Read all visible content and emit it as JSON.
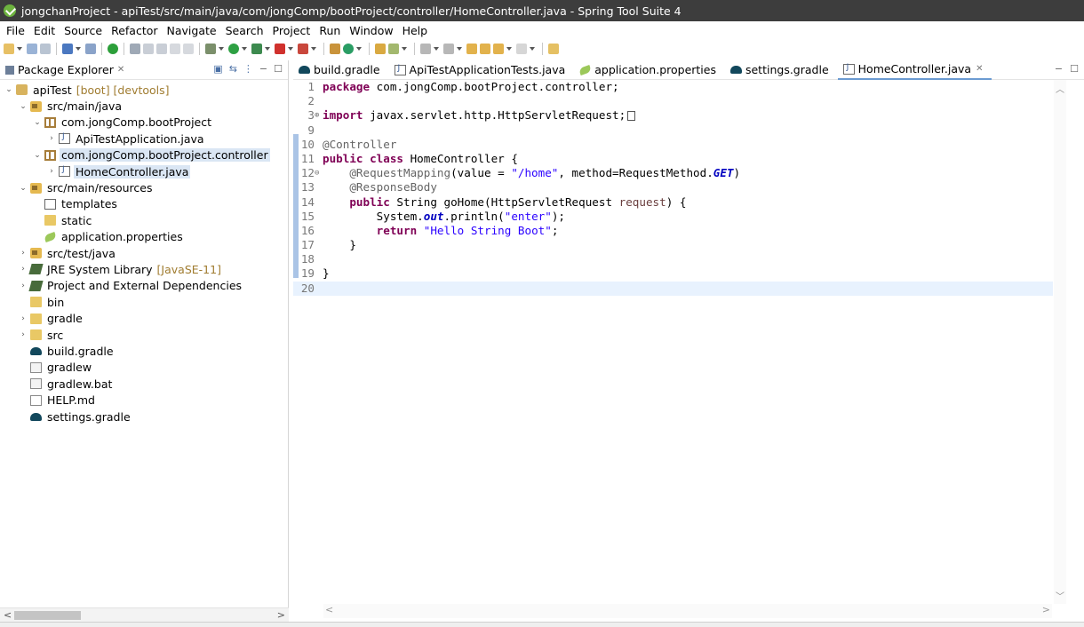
{
  "window": {
    "title": "jongchanProject - apiTest/src/main/java/com/jongComp/bootProject/controller/HomeController.java - Spring Tool Suite 4"
  },
  "menu": [
    "File",
    "Edit",
    "Source",
    "Refactor",
    "Navigate",
    "Search",
    "Project",
    "Run",
    "Window",
    "Help"
  ],
  "package_explorer": {
    "tab_label": "Package Explorer",
    "tree": [
      {
        "label": "apiTest",
        "decor": "[boot] [devtools]",
        "icon": "project-icon",
        "depth": 0,
        "twisty": "expanded"
      },
      {
        "label": "src/main/java",
        "icon": "source-folder-icon",
        "depth": 1,
        "twisty": "expanded"
      },
      {
        "label": "com.jongComp.bootProject",
        "icon": "package-icon",
        "depth": 2,
        "twisty": "expanded"
      },
      {
        "label": "ApiTestApplication.java",
        "icon": "java-file-icon",
        "depth": 3,
        "twisty": "collapsed"
      },
      {
        "label": "com.jongComp.bootProject.controller",
        "icon": "package-icon",
        "depth": 2,
        "twisty": "expanded",
        "highlight": true
      },
      {
        "label": "HomeController.java",
        "icon": "java-file-icon",
        "depth": 3,
        "twisty": "collapsed",
        "selected": true
      },
      {
        "label": "src/main/resources",
        "icon": "source-folder-icon",
        "depth": 1,
        "twisty": "expanded"
      },
      {
        "label": "templates",
        "icon": "templates-icon",
        "depth": 2,
        "twisty": "none"
      },
      {
        "label": "static",
        "icon": "folder-icon",
        "depth": 2,
        "twisty": "none"
      },
      {
        "label": "application.properties",
        "icon": "properties-icon",
        "depth": 2,
        "twisty": "none"
      },
      {
        "label": "src/test/java",
        "icon": "source-folder-icon",
        "depth": 1,
        "twisty": "collapsed"
      },
      {
        "label": "JRE System Library",
        "decor": "[JavaSE-11]",
        "icon": "library-icon",
        "depth": 1,
        "twisty": "collapsed"
      },
      {
        "label": "Project and External Dependencies",
        "icon": "library-icon",
        "depth": 1,
        "twisty": "collapsed"
      },
      {
        "label": "bin",
        "icon": "folder-icon",
        "depth": 1,
        "twisty": "none"
      },
      {
        "label": "gradle",
        "icon": "folder-icon",
        "depth": 1,
        "twisty": "collapsed"
      },
      {
        "label": "src",
        "icon": "folder-icon",
        "depth": 1,
        "twisty": "collapsed"
      },
      {
        "label": "build.gradle",
        "icon": "gradle-icon",
        "depth": 1,
        "twisty": "none"
      },
      {
        "label": "gradlew",
        "icon": "file-icon",
        "depth": 1,
        "twisty": "none"
      },
      {
        "label": "gradlew.bat",
        "icon": "file-icon",
        "depth": 1,
        "twisty": "none"
      },
      {
        "label": "HELP.md",
        "icon": "markdown-icon",
        "depth": 1,
        "twisty": "none"
      },
      {
        "label": "settings.gradle",
        "icon": "gradle-icon",
        "depth": 1,
        "twisty": "none"
      }
    ]
  },
  "editor": {
    "tabs": [
      {
        "label": "build.gradle",
        "icon": "gradle-icon"
      },
      {
        "label": "ApiTestApplicationTests.java",
        "icon": "java-file-icon"
      },
      {
        "label": "application.properties",
        "icon": "properties-icon"
      },
      {
        "label": "settings.gradle",
        "icon": "gradle-icon"
      },
      {
        "label": "HomeController.java",
        "icon": "java-file-icon",
        "active": true
      }
    ],
    "lines": [
      {
        "n": "1",
        "tokens": [
          [
            "kw",
            "package"
          ],
          [
            "",
            "com.jongComp.bootProject.controller;"
          ]
        ]
      },
      {
        "n": "2",
        "tokens": []
      },
      {
        "n": "3",
        "fold": "⊕",
        "tokens": [
          [
            "kw",
            "import"
          ],
          [
            "",
            "javax.servlet.http.HttpServletRequest;"
          ]
        ],
        "collapsed": true
      },
      {
        "n": "9",
        "tokens": []
      },
      {
        "n": "10",
        "tokens": [
          [
            "ann",
            "@Controller"
          ]
        ]
      },
      {
        "n": "11",
        "tokens": [
          [
            "kw",
            "public class"
          ],
          [
            "",
            "HomeController {"
          ]
        ]
      },
      {
        "n": "12",
        "fold": "⊖",
        "tokens": [
          [
            "ann",
            "    @RequestMapping"
          ],
          [
            "",
            "(value = "
          ],
          [
            "str",
            "\"/home\""
          ],
          [
            "",
            ", method=RequestMethod."
          ],
          [
            "static",
            "GET"
          ],
          [
            "",
            ")"
          ]
        ]
      },
      {
        "n": "13",
        "tokens": [
          [
            "ann",
            "    @ResponseBody"
          ]
        ]
      },
      {
        "n": "14",
        "tokens": [
          [
            "kw",
            "    public"
          ],
          [
            "",
            "String goHome(HttpServletRequest "
          ],
          [
            "param",
            "request"
          ],
          [
            "",
            ") {"
          ]
        ]
      },
      {
        "n": "15",
        "tokens": [
          [
            "",
            "        System."
          ],
          [
            "static",
            "out"
          ],
          [
            "",
            ".println("
          ],
          [
            "str",
            "\"enter\""
          ],
          [
            "",
            ");"
          ]
        ]
      },
      {
        "n": "16",
        "tokens": [
          [
            "kw",
            "        return"
          ],
          [
            "str",
            "\"Hello String Boot\""
          ],
          [
            "",
            ";"
          ]
        ]
      },
      {
        "n": "17",
        "tokens": [
          [
            "",
            "    }"
          ]
        ]
      },
      {
        "n": "18",
        "tokens": []
      },
      {
        "n": "19",
        "tokens": [
          [
            "",
            "}"
          ]
        ]
      },
      {
        "n": "20",
        "tokens": [],
        "current": true
      }
    ]
  },
  "colors": {
    "keyword": "#7f0055",
    "annotation": "#646464",
    "string": "#2a00ff",
    "static_field": "#0000c0",
    "selection": "#dae6f4",
    "current_line": "#e8f2fe"
  }
}
